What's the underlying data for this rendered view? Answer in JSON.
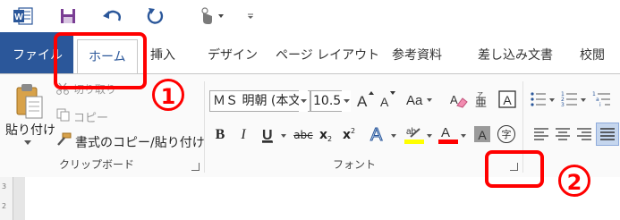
{
  "quick_access": {
    "icons": [
      "word-logo-icon",
      "save-icon",
      "undo-icon",
      "redo-icon",
      "touch-mode-icon",
      "customize-qat-icon"
    ]
  },
  "tabs": {
    "file": "ファイル",
    "home": "ホーム",
    "insert": "挿入",
    "design": "デザイン",
    "layout": "ページ レイアウト",
    "references": "参考資料",
    "mailings": "差し込み文書",
    "review": "校閲"
  },
  "clipboard": {
    "paste": "貼り付け",
    "cut": "切り取り",
    "copy": "コピー",
    "format_painter": "書式のコピー/貼り付け",
    "group_label": "クリップボード"
  },
  "font": {
    "font_name": "ＭＳ 明朝 (本文",
    "font_size": "10.5",
    "group_label": "フォント",
    "subscript": "x",
    "superscript": "x",
    "strike": "abc",
    "enclose": "字",
    "phonetic_guide": "亜"
  },
  "annotations": {
    "marker1": "1",
    "marker2": "2",
    "color": "#ff0000"
  },
  "colors": {
    "file_tab": "#2b579a",
    "font_color_red": "#ff0000",
    "highlight_yellow": "#ffff00"
  }
}
